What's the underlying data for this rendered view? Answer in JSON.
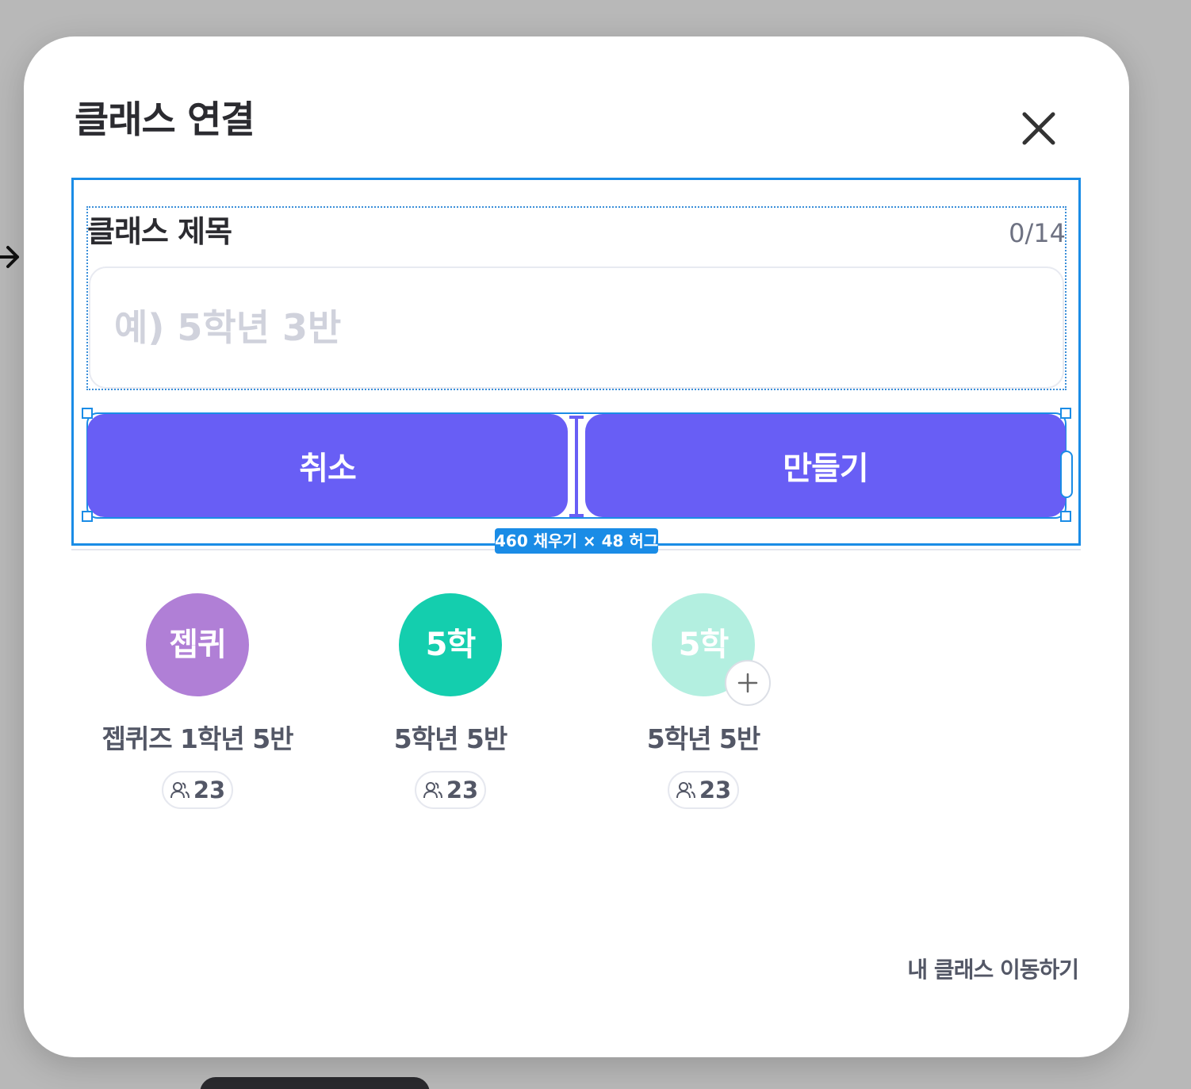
{
  "modal": {
    "title": "클래스 연결"
  },
  "form": {
    "label": "클래스 제목",
    "counter": "0/14",
    "placeholder": "예) 5학년 3반",
    "value": ""
  },
  "actions": {
    "cancel_label": "취소",
    "create_label": "만들기"
  },
  "editor": {
    "size_badge": "460 채우기 × 48 허그"
  },
  "classes": [
    {
      "avatar_text": "젭퀴",
      "name": "젭퀴즈 1학년 5반",
      "members": "23",
      "color": "#b07fd6"
    },
    {
      "avatar_text": "5학",
      "name": "5학년 5반",
      "members": "23",
      "color": "#14ceae"
    },
    {
      "avatar_text": "5학",
      "name": "5학년 5반",
      "members": "23",
      "color": "#b3efe0"
    }
  ],
  "footer": {
    "link_label": "내 클래스 이동하기"
  },
  "colors": {
    "primary": "#685ef5",
    "selection": "#1a8ce6",
    "backdrop": "#b8b8b8"
  },
  "icons": {
    "close": "close-icon",
    "members": "users-icon",
    "add": "plus-icon",
    "arrow": "arrow-right-icon"
  }
}
